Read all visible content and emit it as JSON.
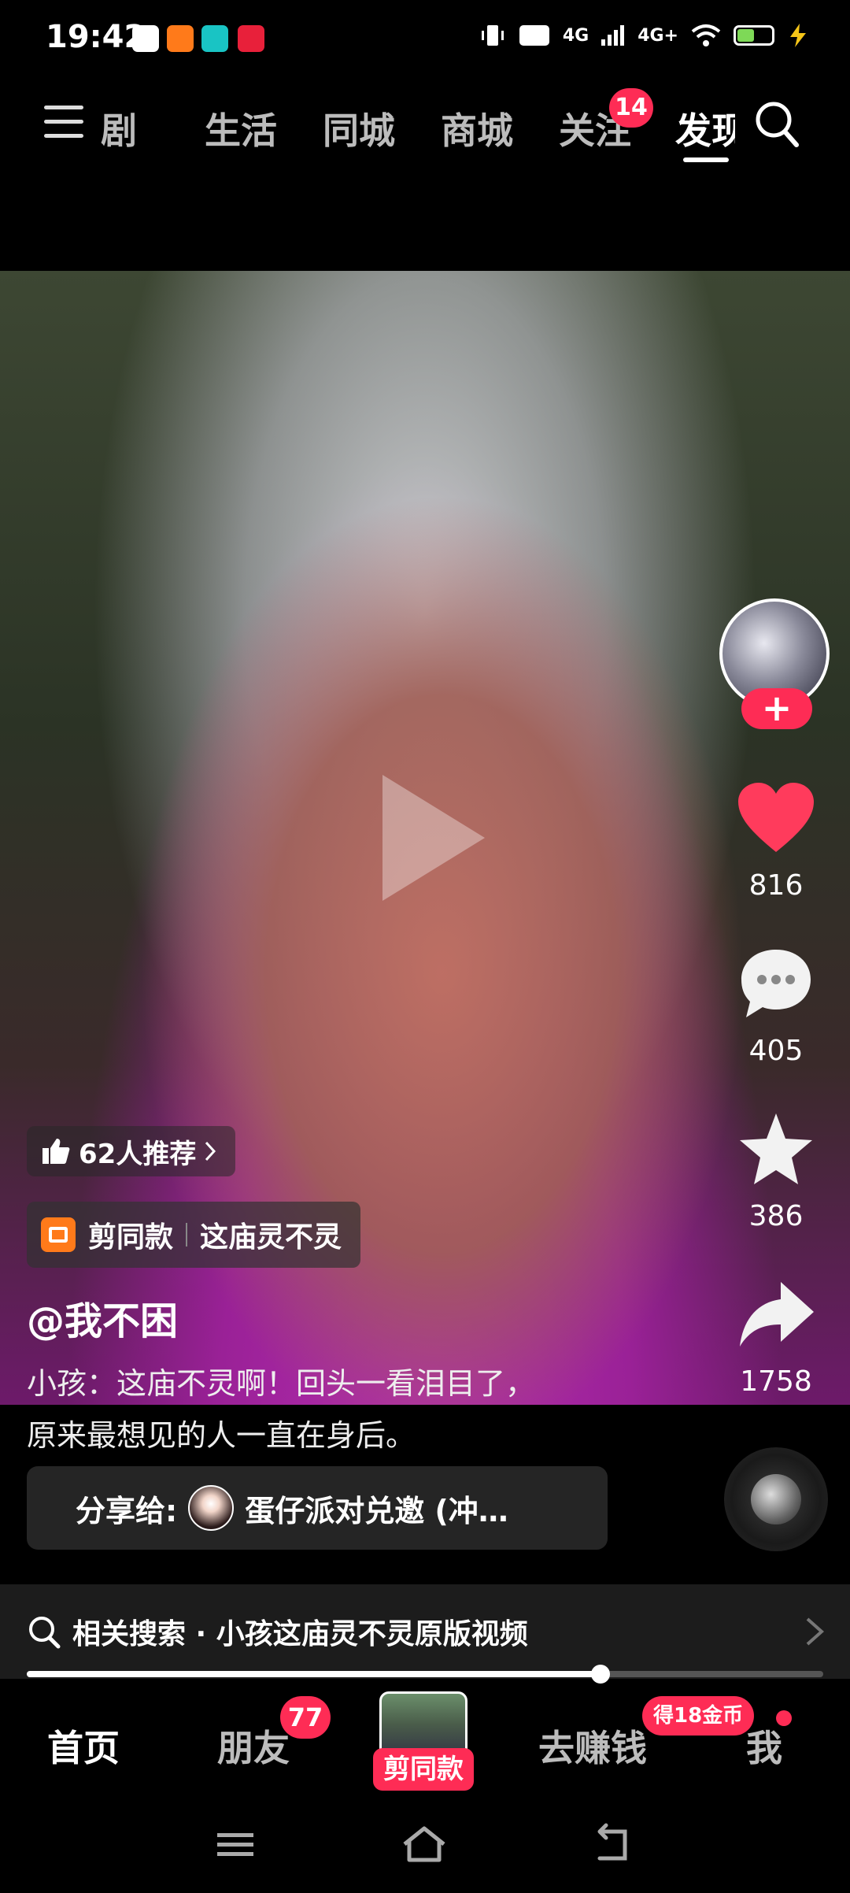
{
  "status_bar": {
    "time": "19:42",
    "network_1": "4G",
    "network_2": "4G+"
  },
  "top_nav": {
    "tabs": [
      "剧",
      "生活",
      "同城",
      "商城",
      "关注",
      "发现"
    ],
    "follow_badge": "14",
    "active_tab_index": 5
  },
  "video": {
    "likes": "816",
    "comments": "405",
    "favorites": "386",
    "shares": "1758",
    "follow_label": "+",
    "recommend": "62人推荐",
    "capcut_label": "剪同款",
    "capcut_template": "这庙灵不灵",
    "author": "@我不困",
    "caption_line1": "小孩：这庙不灵啊！回头一看泪目了，",
    "caption_line2": "原来最想见的人一直在身后。",
    "share_prefix": "分享给:",
    "share_target": "蛋仔派对兑邀 (冲…",
    "progress": 0.72
  },
  "related_search": {
    "label": "相关搜索 · 小孩这庙灵不灵原版视频"
  },
  "bottom_tabs": {
    "home": "首页",
    "friends": "朋友",
    "friends_badge": "77",
    "center_label": "剪同款",
    "earn": "去赚钱",
    "earn_badge": "得18金币",
    "me": "我"
  },
  "colors": {
    "accent": "#fe2c55",
    "like": "#ff3b5c",
    "background": "#000000"
  }
}
